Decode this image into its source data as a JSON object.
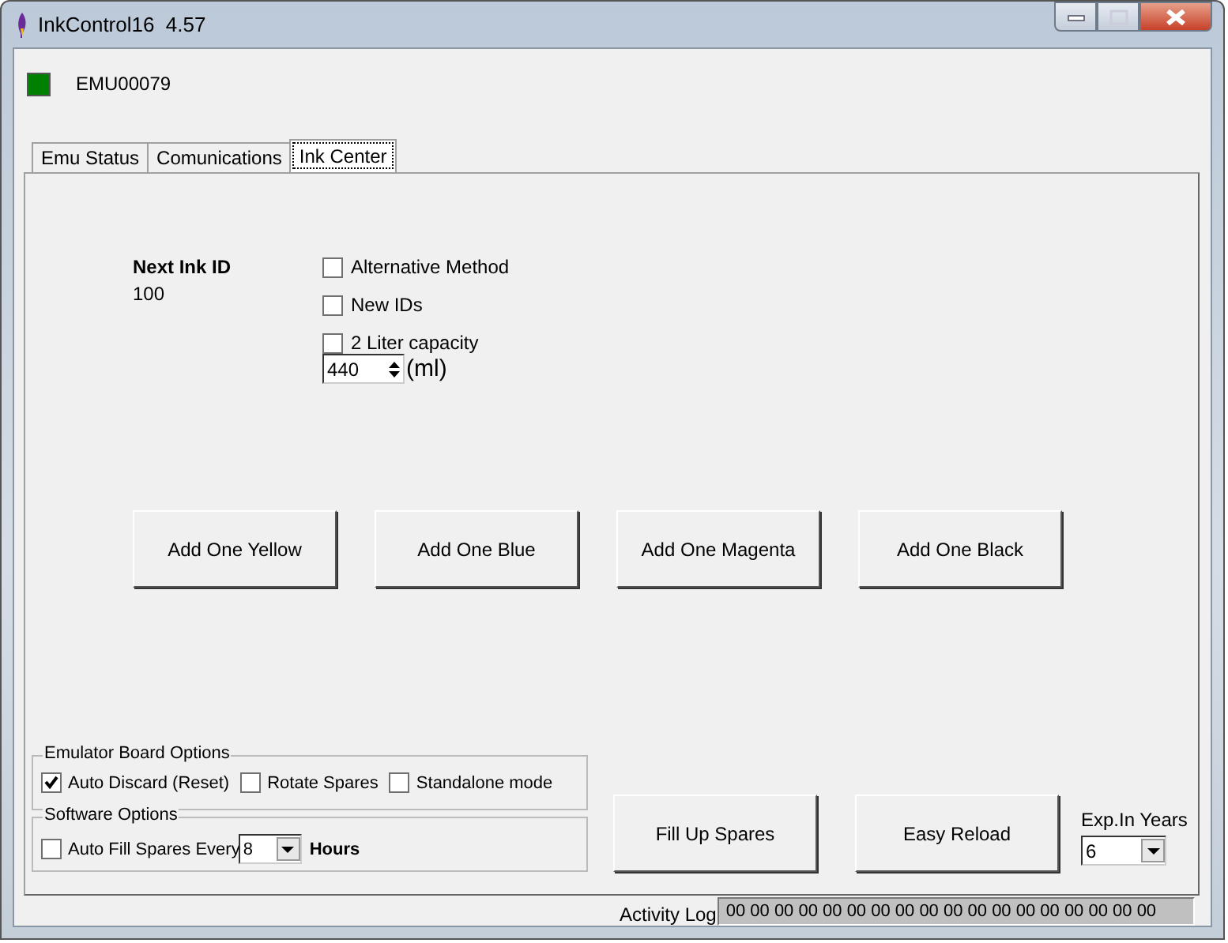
{
  "window": {
    "title": "InkControl16  4.57"
  },
  "status": {
    "connected": true,
    "device": "EMU00079"
  },
  "tabs": [
    {
      "label": "Emu Status",
      "selected": false
    },
    {
      "label": "Comunications",
      "selected": false
    },
    {
      "label": "Ink Center",
      "selected": true
    }
  ],
  "next_ink": {
    "label": "Next Ink ID",
    "value": "100"
  },
  "options": [
    {
      "label": "Alternative Method",
      "checked": false
    },
    {
      "label": "New IDs",
      "checked": false
    },
    {
      "label": "2 Liter capacity",
      "checked": false
    }
  ],
  "capacity": {
    "value": "440",
    "unit": "(ml)"
  },
  "add_buttons": [
    "Add One Yellow",
    "Add One Blue",
    "Add One Magenta",
    "Add One Black"
  ],
  "emulator_group": {
    "title": "Emulator Board Options",
    "options": [
      {
        "label": "Auto Discard (Reset)",
        "checked": true
      },
      {
        "label": "Rotate Spares",
        "checked": false
      },
      {
        "label": "Standalone mode",
        "checked": false
      }
    ]
  },
  "software_group": {
    "title": "Software Options",
    "option": {
      "label": "Auto Fill Spares Every",
      "checked": false
    },
    "interval": "8",
    "unit": "Hours"
  },
  "actions": [
    "Fill Up Spares",
    "Easy Reload"
  ],
  "expiry": {
    "label": "Exp.In Years",
    "value": "6"
  },
  "activity_log": {
    "label": "Activity Log",
    "value": "00 00 00 00 00 00 00 00 00 00 00 00 00 00 00 00 00 00"
  }
}
